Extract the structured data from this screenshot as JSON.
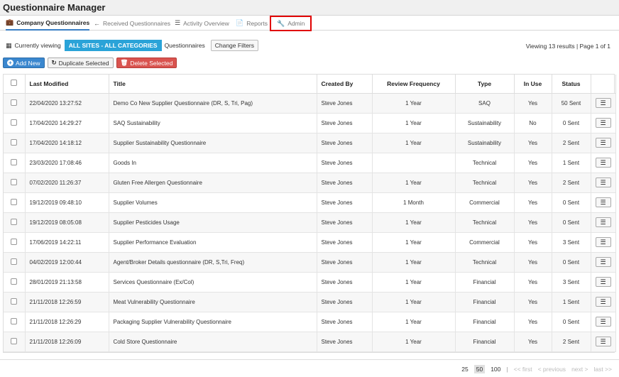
{
  "app": {
    "title": "Questionnaire Manager"
  },
  "tabs": [
    {
      "label": "Company Questionnaires",
      "icon": "briefcase-icon",
      "glyph": "💼"
    },
    {
      "label": "Received Questionnaires",
      "icon": "arrow-left-icon",
      "glyph": "←"
    },
    {
      "label": "Activity Overview",
      "icon": "list-icon",
      "glyph": "☰"
    },
    {
      "label": "Reports",
      "icon": "document-icon",
      "glyph": "📄"
    },
    {
      "label": "Admin",
      "icon": "wrench-icon",
      "glyph": "🔧"
    }
  ],
  "filters": {
    "currently_viewing_label": "Currently viewing",
    "scope": "ALL SITES - ALL CATEGORIES",
    "questionnaires_label": "Questionnaires",
    "change_filters_label": "Change Filters",
    "viewing_text": "Viewing 13 results | Page 1 of 1"
  },
  "actions": {
    "add_new": "Add New",
    "duplicate": "Duplicate Selected",
    "delete": "Delete Selected"
  },
  "table": {
    "headers": {
      "last_modified": "Last Modified",
      "title": "Title",
      "created_by": "Created By",
      "review_frequency": "Review Frequency",
      "type": "Type",
      "in_use": "In Use",
      "status": "Status"
    },
    "rows": [
      {
        "modified": "22/04/2020 13:27:52",
        "title": "Demo Co New Supplier Questionnaire (DR, S, Tri, Pag)",
        "created_by": "Steve Jones",
        "frequency": "1 Year",
        "type": "SAQ",
        "in_use": "Yes",
        "status": "50 Sent"
      },
      {
        "modified": "17/04/2020 14:29:27",
        "title": "SAQ Sustainability",
        "created_by": "Steve Jones",
        "frequency": "1 Year",
        "type": "Sustainability",
        "in_use": "No",
        "status": "0 Sent"
      },
      {
        "modified": "17/04/2020 14:18:12",
        "title": "Supplier Sustainability Questionnaire",
        "created_by": "Steve Jones",
        "frequency": "1 Year",
        "type": "Sustainability",
        "in_use": "Yes",
        "status": "2 Sent"
      },
      {
        "modified": "23/03/2020 17:08:46",
        "title": "Goods In",
        "created_by": "Steve Jones",
        "frequency": "",
        "type": "Technical",
        "in_use": "Yes",
        "status": "1 Sent"
      },
      {
        "modified": "07/02/2020 11:26:37",
        "title": "Gluten Free Allergen Questionnaire",
        "created_by": "Steve Jones",
        "frequency": "1 Year",
        "type": "Technical",
        "in_use": "Yes",
        "status": "2 Sent"
      },
      {
        "modified": "19/12/2019 09:48:10",
        "title": "Supplier Volumes",
        "created_by": "Steve Jones",
        "frequency": "1 Month",
        "type": "Commercial",
        "in_use": "Yes",
        "status": "0 Sent"
      },
      {
        "modified": "19/12/2019 08:05:08",
        "title": "Supplier Pesticides Usage",
        "created_by": "Steve Jones",
        "frequency": "1 Year",
        "type": "Technical",
        "in_use": "Yes",
        "status": "0 Sent"
      },
      {
        "modified": "17/06/2019 14:22:11",
        "title": "Supplier Performance Evaluation",
        "created_by": "Steve Jones",
        "frequency": "1 Year",
        "type": "Commercial",
        "in_use": "Yes",
        "status": "3 Sent"
      },
      {
        "modified": "04/02/2019 12:00:44",
        "title": "Agent/Broker Details questionnaire (DR, S,Tri, Freq)",
        "created_by": "Steve Jones",
        "frequency": "1 Year",
        "type": "Technical",
        "in_use": "Yes",
        "status": "0 Sent"
      },
      {
        "modified": "28/01/2019 21:13:58",
        "title": "Services Questionnaire (Ex/Col)",
        "created_by": "Steve Jones",
        "frequency": "1 Year",
        "type": "Financial",
        "in_use": "Yes",
        "status": "3 Sent"
      },
      {
        "modified": "21/11/2018 12:26:59",
        "title": "Meat Vulnerability Questionnaire",
        "created_by": "Steve Jones",
        "frequency": "1 Year",
        "type": "Financial",
        "in_use": "Yes",
        "status": "1 Sent"
      },
      {
        "modified": "21/11/2018 12:26:29",
        "title": "Packaging Supplier Vulnerability Questionnaire",
        "created_by": "Steve Jones",
        "frequency": "1 Year",
        "type": "Financial",
        "in_use": "Yes",
        "status": "0 Sent"
      },
      {
        "modified": "21/11/2018 12:26:09",
        "title": "Cold Store Questionnaire",
        "created_by": "Steve Jones",
        "frequency": "1 Year",
        "type": "Financial",
        "in_use": "Yes",
        "status": "2 Sent"
      }
    ]
  },
  "pager": {
    "sizes": [
      "25",
      "50",
      "100"
    ],
    "selected_size": "50",
    "separator": "|",
    "first": "<< first",
    "previous": "< previous",
    "next": "next >",
    "last": "last >>"
  },
  "colors": {
    "accent_blue": "#3a87cf",
    "scope_badge": "#2aa3d8",
    "delete_red": "#d9534f",
    "highlight_box": "#e00000"
  }
}
